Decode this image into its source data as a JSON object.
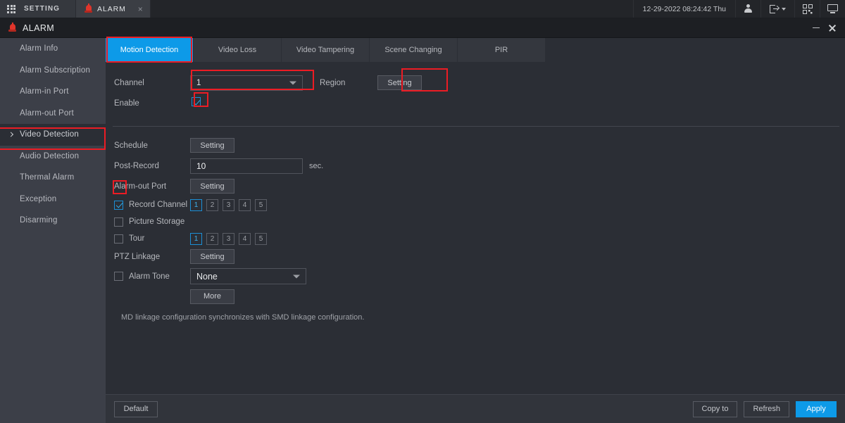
{
  "topbar": {
    "setting_label": "SETTING",
    "setting_icon": "grid-icon",
    "tab": {
      "label": "ALARM",
      "icon": "siren-icon",
      "close": "×"
    },
    "datetime": "12-29-2022 08:24:42 Thu",
    "icons": [
      "user-icon",
      "logout-icon",
      "qrcode-icon",
      "monitor-icon"
    ]
  },
  "window": {
    "title": "ALARM",
    "icon": "siren-icon",
    "minimize": "minimize-icon",
    "close": "close-icon"
  },
  "sidebar": {
    "items": [
      {
        "label": "Alarm Info",
        "active": false
      },
      {
        "label": "Alarm Subscription",
        "active": false
      },
      {
        "label": "Alarm-in Port",
        "active": false
      },
      {
        "label": "Alarm-out Port",
        "active": false
      },
      {
        "label": "Video Detection",
        "active": true
      },
      {
        "label": "Audio Detection",
        "active": false
      },
      {
        "label": "Thermal Alarm",
        "active": false
      },
      {
        "label": "Exception",
        "active": false
      },
      {
        "label": "Disarming",
        "active": false
      }
    ]
  },
  "tabs": [
    {
      "label": "Motion Detection",
      "active": true
    },
    {
      "label": "Video Loss",
      "active": false
    },
    {
      "label": "Video Tampering",
      "active": false
    },
    {
      "label": "Scene Changing",
      "active": false
    },
    {
      "label": "PIR",
      "active": false
    }
  ],
  "form": {
    "channel_label": "Channel",
    "channel_value": "1",
    "region_label": "Region",
    "region_button": "Setting",
    "enable_label": "Enable",
    "enable_checked": true,
    "schedule_label": "Schedule",
    "schedule_button": "Setting",
    "post_record_label": "Post-Record",
    "post_record_value": "10",
    "post_record_unit": "sec.",
    "alarm_out_label": "Alarm-out Port",
    "alarm_out_button": "Setting",
    "record_channel_label": "Record Channel",
    "record_channel_checked": true,
    "record_channels": [
      "1",
      "2",
      "3",
      "4",
      "5"
    ],
    "record_channel_selected": "1",
    "picture_storage_label": "Picture Storage",
    "picture_storage_checked": false,
    "tour_label": "Tour",
    "tour_checked": false,
    "tour_channels": [
      "1",
      "2",
      "3",
      "4",
      "5"
    ],
    "tour_selected": "1",
    "ptz_label": "PTZ Linkage",
    "ptz_button": "Setting",
    "alarm_tone_label": "Alarm Tone",
    "alarm_tone_checked": false,
    "alarm_tone_value": "None",
    "more_button": "More",
    "note": "MD linkage configuration synchronizes with SMD linkage configuration."
  },
  "footer": {
    "default_button": "Default",
    "copy_to_button": "Copy to",
    "refresh_button": "Refresh",
    "apply_button": "Apply"
  },
  "colors": {
    "accent": "#0d9ae8",
    "highlight": "#ec1c24",
    "sidebar_bg": "#3c3f48",
    "main_bg": "#2b2e35",
    "alarm_red": "#e0352b"
  }
}
